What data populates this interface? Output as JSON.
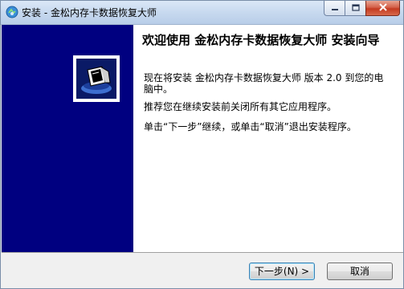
{
  "window": {
    "title": "安装 - 金松内存卡数据恢复大师"
  },
  "content": {
    "heading": "欢迎使用 金松内存卡数据恢复大师 安装向导",
    "para1": "现在将安装 金松内存卡数据恢复大师 版本 2.0 到您的电脑中。",
    "para2": "推荐您在继续安装前关闭所有其它应用程序。",
    "para3": "单击“下一步”继续，或单击“取消”退出安装程序。"
  },
  "buttons": {
    "next_label": "下一步(N) >",
    "cancel_label": "取消"
  },
  "icons": {
    "app": "installer-app-icon",
    "wizard": "installer-wizard-logo",
    "minimize": "minimize-icon",
    "maximize": "maximize-icon",
    "close": "close-icon"
  },
  "colors": {
    "sidebar": "#000080",
    "content_bg": "#ffffff",
    "footer_bg": "#f0f0f0",
    "close_button": "#c43a20"
  }
}
